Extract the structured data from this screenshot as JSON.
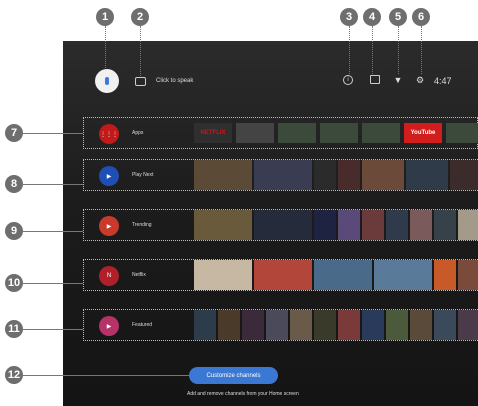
{
  "header": {
    "speak_label": "Click to speak",
    "clock": "4:47"
  },
  "callouts": [
    "1",
    "2",
    "3",
    "4",
    "5",
    "6",
    "7",
    "8",
    "9",
    "10",
    "11",
    "12"
  ],
  "rows": [
    {
      "label": "Apps",
      "icon_color": "#c21a1a",
      "apps": [
        "NETFLIX",
        "",
        "",
        "",
        "",
        "YouTube",
        ""
      ]
    },
    {
      "label": "Play Next",
      "icon_color": "#1f4fb5",
      "tiles": [
        "#5a4a36",
        "#3a3d52",
        "#2b2b2b",
        "#4a2b2b",
        "#6b4a3a",
        "#2f3b49",
        "#3b2b2b"
      ]
    },
    {
      "label": "Trending",
      "icon_color": "#c93a2a",
      "tiles": [
        "#6a5a3c",
        "#252b3a",
        "#1d2340",
        "#5a4a7a",
        "#6b3a3a",
        "#2f3a4a",
        "#7a5a5a",
        "#36414a",
        "#a49a8a"
      ]
    },
    {
      "label": "Netflix",
      "icon_color": "#b0202a",
      "tiles": [
        "#c7b8a3",
        "#b3463a",
        "#4a6a8a",
        "#5a7a9a",
        "#c85a2a",
        "#7a4a3a"
      ]
    },
    {
      "label": "Featured",
      "icon_color": "#b53366",
      "tiles": [
        "#2d3c4a",
        "#4a3a2a",
        "#3a2a3a",
        "#4a4a5a",
        "#6a5a4a",
        "#3a3a2a",
        "#7a3a3a",
        "#2a3a5a",
        "#4a5a3a",
        "#5a4a3a",
        "#3a4a5a",
        "#4a3a4a"
      ]
    }
  ],
  "customize": {
    "button": "Customize channels",
    "hint": "Add and remove channels from your Home screen"
  }
}
